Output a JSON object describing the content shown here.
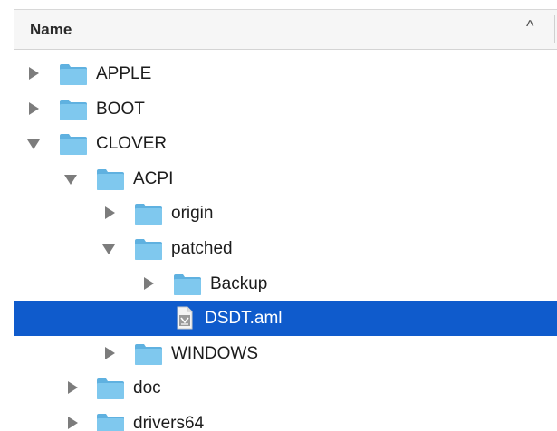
{
  "header": {
    "name_label": "Name",
    "sort_indicator": "^"
  },
  "rows": [
    {
      "label": "APPLE",
      "type": "folder",
      "expanded": false
    },
    {
      "label": "BOOT",
      "type": "folder",
      "expanded": false
    },
    {
      "label": "CLOVER",
      "type": "folder",
      "expanded": true
    },
    {
      "label": "ACPI",
      "type": "folder",
      "expanded": true
    },
    {
      "label": "origin",
      "type": "folder",
      "expanded": false
    },
    {
      "label": "patched",
      "type": "folder",
      "expanded": true
    },
    {
      "label": "Backup",
      "type": "folder",
      "expanded": false
    },
    {
      "label": "DSDT.aml",
      "type": "file",
      "selected": true
    },
    {
      "label": "WINDOWS",
      "type": "folder",
      "expanded": false
    },
    {
      "label": "doc",
      "type": "folder",
      "expanded": false
    },
    {
      "label": "drivers64",
      "type": "folder",
      "expanded": false
    }
  ],
  "colors": {
    "selection": "#0f5bcc",
    "folder_front": "#7fc8ee",
    "folder_back": "#5fb1e0"
  }
}
